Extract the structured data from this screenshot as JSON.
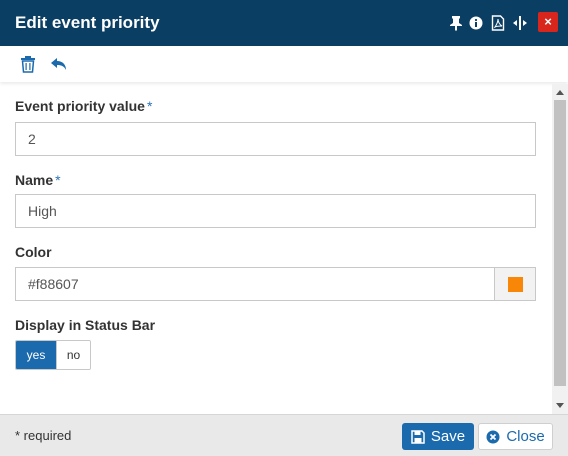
{
  "window": {
    "title": "Edit event priority",
    "close_label": "×"
  },
  "titlebar_icons": [
    "pin-icon",
    "info-icon",
    "pdf-icon",
    "resize-width-icon"
  ],
  "toolbar": {
    "icons": [
      "trash-icon",
      "undo-icon"
    ]
  },
  "form": {
    "priority": {
      "label": "Event priority value",
      "required_mark": "*",
      "value": "2"
    },
    "name": {
      "label": "Name",
      "required_mark": "*",
      "value": "High"
    },
    "color": {
      "label": "Color",
      "value": "#f88607",
      "swatch": "#f88607"
    },
    "status_bar": {
      "label": "Display in Status Bar",
      "yes": "yes",
      "no": "no",
      "selected": "yes"
    }
  },
  "footer": {
    "required_note": "* required",
    "save_label": "Save",
    "close_label": "Close"
  },
  "colors": {
    "titlebar": "#0b3e63",
    "accent": "#1a6aad",
    "close_red": "#d9261c"
  }
}
